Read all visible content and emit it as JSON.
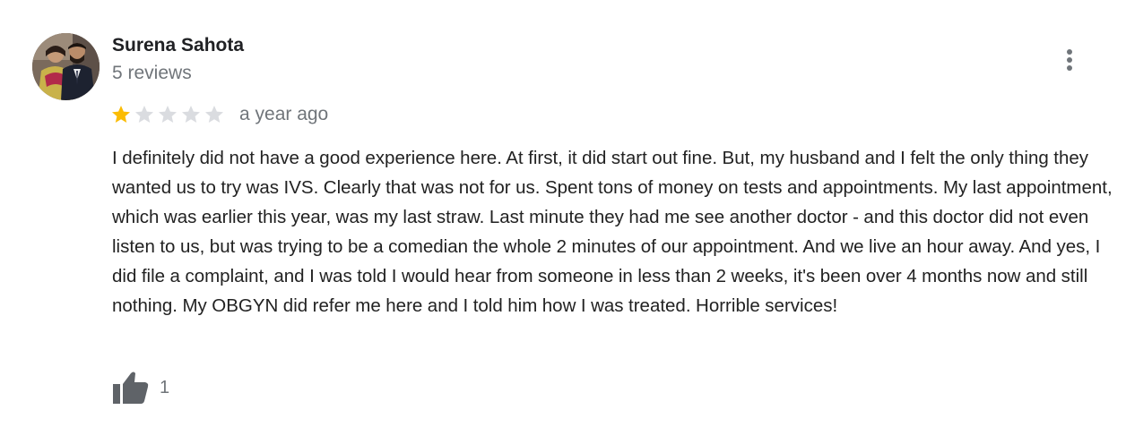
{
  "review": {
    "author": {
      "name": "Surena Sahota",
      "review_count": "5 reviews",
      "avatar_icon": "profile-photo"
    },
    "rating": {
      "value": 1,
      "max": 5,
      "filled_color": "#fbbc04",
      "empty_color": "#dadce0"
    },
    "date": "a year ago",
    "text": "I definitely did not have a good experience here. At first, it did start out fine. But, my husband and I felt the only thing they wanted us to try was IVS. Clearly that was not for us. Spent tons of money on tests and appointments. My last appointment, which was earlier this year, was my last straw. Last minute they had me see another doctor - and this doctor did not even listen to us, but was trying to be a comedian the whole 2 minutes of our appointment. And we live an hour away. And yes, I did file a complaint, and I was told I would hear from someone in less than 2 weeks, it's been over 4 months now and still nothing. My OBGYN did refer me here and I told him how I was treated. Horrible services!",
    "likes": {
      "count": "1",
      "icon": "thumbs-up-icon"
    },
    "menu_icon": "more-vert-icon"
  }
}
